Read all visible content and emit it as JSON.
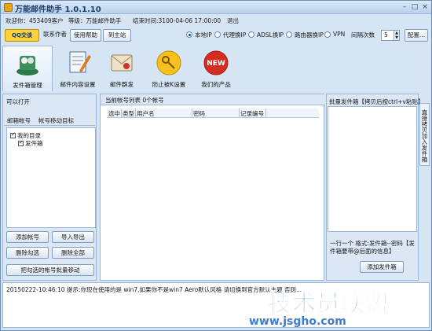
{
  "window": {
    "title": "万能邮件助手 1.0.1.10",
    "minimize": "–",
    "restore": "□",
    "close": "×"
  },
  "info": {
    "welcome": "欢迎你：453409客户",
    "level": "等级：万能邮件助手",
    "end_time": "结束时间:3100-04-06 17:00:00",
    "logout": "退出"
  },
  "toolbar": {
    "qq": "QQ交谈",
    "contact_author": "联系作者",
    "help": "使用帮助",
    "home": "到主站",
    "ip_options": [
      "本地IP",
      "代理换IP",
      "ADSL换IP",
      "路由器换IP",
      "VPN"
    ],
    "selected_ip": "本地IP",
    "interval_label": "间隔次数",
    "interval_value": "5",
    "config": "配置..."
  },
  "icon_tools": [
    {
      "label": "发件箱管理",
      "icon": "mailbox-manage"
    },
    {
      "label": "邮件内容设置",
      "icon": "mail-content"
    },
    {
      "label": "邮件群发",
      "icon": "mass-send"
    },
    {
      "label": "防止被K设置",
      "icon": "key-protect"
    },
    {
      "label": "我们的产品",
      "icon": "new-product"
    }
  ],
  "left_panel": {
    "title": "可以打开",
    "tabs": [
      "邮箱帐号",
      "帐号移动目标"
    ],
    "tree": {
      "root": "我的目录",
      "child": "发件箱"
    },
    "buttons": {
      "add": "添加帐号",
      "import_export": "导入导出",
      "delete_checked": "删除勾选",
      "delete_all": "删除全部",
      "batch_move": "把勾选的帐号批量移动"
    }
  },
  "center_panel": {
    "tab": "当前帐号列表 0个帐号",
    "columns": [
      "选中",
      "类型",
      "用户名",
      "密码",
      "记录编号"
    ]
  },
  "right_panel": {
    "title": "批量发件箱【拷贝后按ctrl+v粘贴】",
    "hint": "一行一个 格式:发件箱--密码【发件箱要带@后面的信息】",
    "add_button": "添加发件箱",
    "side_tab": "直接拷贝加入发件箱"
  },
  "log": {
    "line": "20150222-10:46:10  提示:你现在使用的是 win7,如果你不是win7 Aero默认风格 请切换到官方默认主题 否则..."
  },
  "watermark": {
    "text": "技术员联盟",
    "url": "www.jsgho.com"
  }
}
